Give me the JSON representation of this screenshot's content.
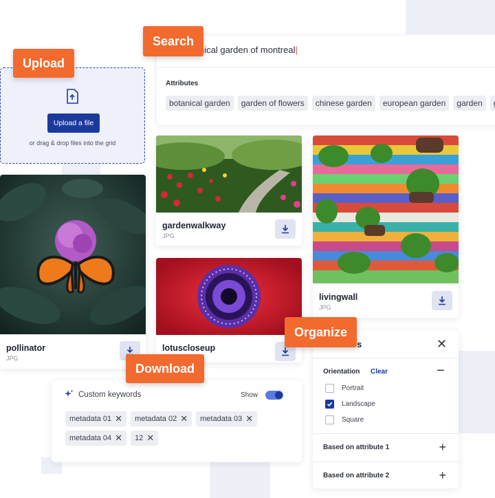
{
  "badges": {
    "search": "Search",
    "upload": "Upload",
    "organize": "Organize",
    "download": "Download"
  },
  "search": {
    "query": "nical garden of montreal",
    "attributes_label": "Attributes",
    "chips": [
      "botanical garden",
      "garden of flowers",
      "chinese garden",
      "european garden",
      "garden",
      "gardenn"
    ]
  },
  "upload": {
    "button_label": "Upload a file",
    "hint": "or drag & drop files into the grid"
  },
  "assets": [
    {
      "name": "gardenwalkway",
      "type": "JPG"
    },
    {
      "name": "livingwall",
      "type": "JPG"
    },
    {
      "name": "pollinator",
      "type": "JPG"
    },
    {
      "name": "lotuscloseup",
      "type": "JPG"
    }
  ],
  "filters": {
    "title_fragment": "s",
    "orientation_label": "Orientation",
    "clear_label": "Clear",
    "options": [
      {
        "label": "Portrait",
        "checked": false
      },
      {
        "label": "Landscape",
        "checked": true
      },
      {
        "label": "Square",
        "checked": false
      }
    ],
    "attribute_sections": [
      "Based on attribute 1",
      "Based on attribute 2"
    ]
  },
  "keywords": {
    "title": "Custom keywords",
    "show_label": "Show",
    "show_enabled": true,
    "tags": [
      "metadata 01",
      "metadata 02",
      "metadata 03",
      "metadata 04",
      "12"
    ]
  },
  "colors": {
    "accent": "#f26a2e",
    "primary": "#1b3a9c",
    "toggle": "#3a5bd6"
  }
}
